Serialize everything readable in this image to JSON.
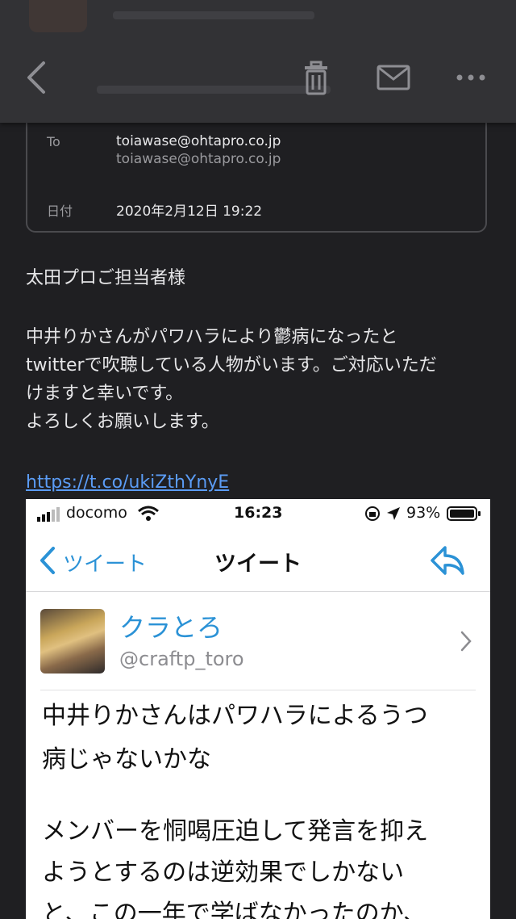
{
  "header": {
    "to_label": "To",
    "to_value": "toiawase@ohtapro.co.jp",
    "to_value2": "toiawase@ohtapro.co.jp",
    "date_label": "日付",
    "date_value": "2020年2月12日 19:22"
  },
  "body": {
    "greeting": "太田プロご担当者様",
    "paragraph_lines": [
      "中井りかさんがパワハラにより鬱病になったと",
      "twitterで吹聴している人物がいます。ご対応いただ",
      "けますと幸いです。",
      "よろしくお願いします。"
    ],
    "link": "https://t.co/ukiZthYnyE"
  },
  "embed": {
    "carrier": "docomo",
    "time": "16:23",
    "battery": "93%",
    "nav_back_label": "ツイート",
    "nav_title": "ツイート",
    "user_name": "クラとろ",
    "user_handle": "@craftp_toro",
    "tweet_lines": [
      "中井りかさんはパワハラによるうつ",
      "病じゃないかな",
      "",
      "メンバーを恫喝圧迫して発言を抑え",
      "ようとするのは逆効果でしかない",
      "と、この一年で学ばなかったのか、"
    ]
  },
  "colors": {
    "background": "#1f1f22",
    "toolbar": "#323235",
    "link": "#5b9cf5",
    "twitter_blue": "#2b92d6"
  },
  "icons": [
    "back-icon",
    "trash-icon",
    "mail-icon",
    "more-icon",
    "wifi-icon",
    "signal-icon",
    "battery-icon",
    "reply-icon",
    "chevron-right-icon"
  ]
}
